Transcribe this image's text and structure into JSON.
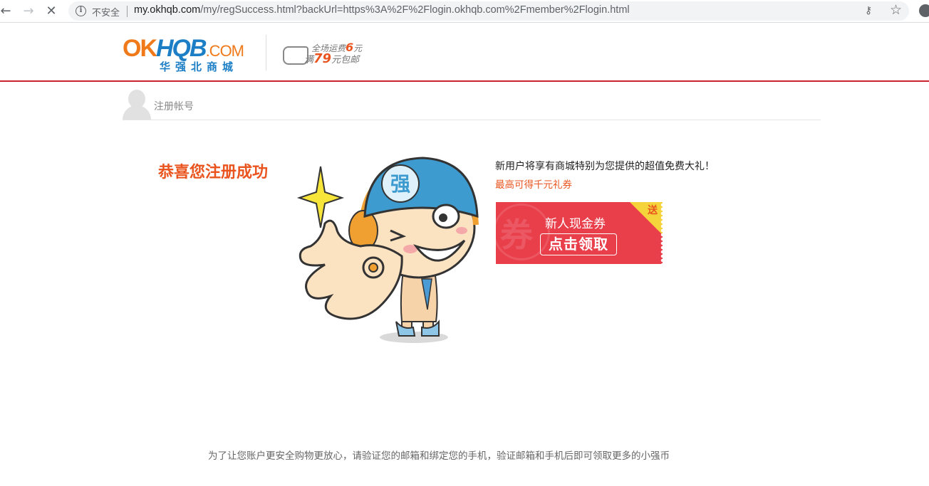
{
  "browser": {
    "back_glyph": "←",
    "forward_glyph": "→",
    "stop_glyph": "✕",
    "info_glyph": "i",
    "security_label": "不安全",
    "url_host": "my.okhqb.com",
    "url_path": "/my/regSuccess.html?backUrl=https%3A%2F%2Flogin.okhqb.com%2Fmember%2Flogin.html",
    "key_glyph": "⚷",
    "star_glyph": "☆"
  },
  "header": {
    "logo_ok": "OK",
    "logo_hqb": "HQB",
    "logo_com": ".COM",
    "logo_sub": "华强北商城",
    "shipping_line1_prefix": "全场运费",
    "shipping_line1_amount": "6",
    "shipping_line1_suffix": "元",
    "shipping_line2_prefix": "满",
    "shipping_line2_amount": "79",
    "shipping_line2_suffix": "元包邮"
  },
  "reg_bar": {
    "title": "注册帐号"
  },
  "main": {
    "success_title": "恭喜您注册成功",
    "gift_text": "新用户将享有商城特别为您提供的超值免费大礼！",
    "gift_sub": "最高可得千元礼券",
    "mascot_cap_glyph": "强"
  },
  "coupon": {
    "watermark": "券",
    "title": "新人现金券",
    "button": "点击领取",
    "corner": "送"
  },
  "footer": {
    "note": "为了让您账户更安全购物更放心，请验证您的邮箱和绑定您的手机，验证邮箱和手机后即可领取更多的小强币"
  },
  "colors": {
    "brand_red": "#c9232e",
    "accent_orange": "#e9541f",
    "logo_blue": "#1c7fc6",
    "coupon_red": "#e93f4b",
    "coupon_corner_yellow": "#f5d33b"
  }
}
